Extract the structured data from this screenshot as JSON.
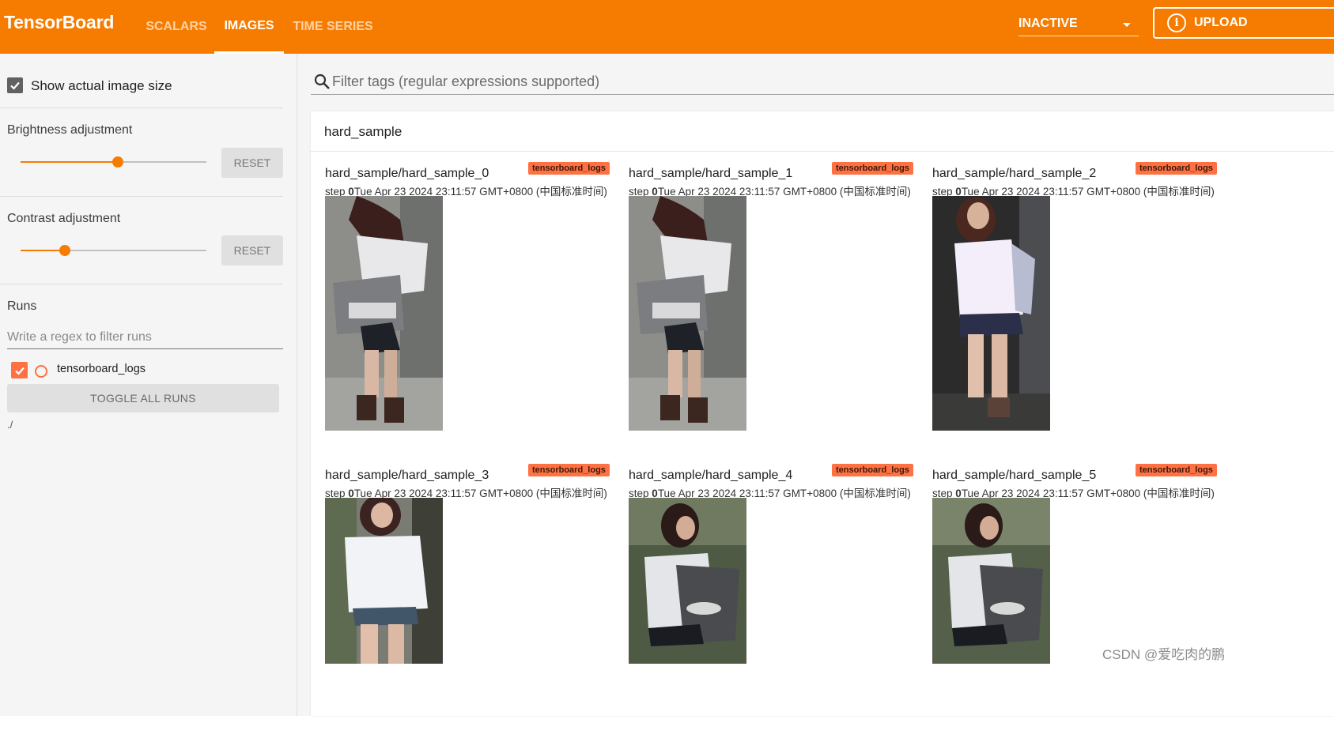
{
  "header": {
    "brand": "TensorBoard",
    "tabs": [
      {
        "label": "SCALARS",
        "active": false
      },
      {
        "label": "IMAGES",
        "active": true
      },
      {
        "label": "TIME SERIES",
        "active": false
      }
    ],
    "reload_status": "INACTIVE",
    "upload_label": "UPLOAD",
    "accent": "#f57c00"
  },
  "sidebar": {
    "show_actual_size_label": "Show actual image size",
    "show_actual_size_checked": true,
    "brightness": {
      "label": "Brightness adjustment",
      "reset": "RESET",
      "value_fraction": 0.52
    },
    "contrast": {
      "label": "Contrast adjustment",
      "reset": "RESET",
      "value_fraction": 0.24
    },
    "runs": {
      "title": "Runs",
      "filter_placeholder": "Write a regex to filter runs",
      "items": [
        {
          "name": "tensorboard_logs",
          "checked": true,
          "color": "#ff7043"
        }
      ],
      "toggle_all": "TOGGLE ALL RUNS",
      "path": "./"
    }
  },
  "main": {
    "filter_placeholder": "Filter tags (regular expressions supported)",
    "group_title": "hard_sample",
    "images": [
      {
        "tag": "hard_sample/hard_sample_0",
        "run": "tensorboard_logs",
        "step_label": "step",
        "step": "0",
        "time": "Tue Apr 23 2024 23:11:57 GMT+0800 (中国标准时间)"
      },
      {
        "tag": "hard_sample/hard_sample_1",
        "run": "tensorboard_logs",
        "step_label": "step",
        "step": "0",
        "time": "Tue Apr 23 2024 23:11:57 GMT+0800 (中国标准时间)"
      },
      {
        "tag": "hard_sample/hard_sample_2",
        "run": "tensorboard_logs",
        "step_label": "step",
        "step": "0",
        "time": "Tue Apr 23 2024 23:11:57 GMT+0800 (中国标准时间)"
      },
      {
        "tag": "hard_sample/hard_sample_3",
        "run": "tensorboard_logs",
        "step_label": "step",
        "step": "0",
        "time": "Tue Apr 23 2024 23:11:57 GMT+0800 (中国标准时间)"
      },
      {
        "tag": "hard_sample/hard_sample_4",
        "run": "tensorboard_logs",
        "step_label": "step",
        "step": "0",
        "time": "Tue Apr 23 2024 23:11:57 GMT+0800 (中国标准时间)"
      },
      {
        "tag": "hard_sample/hard_sample_5",
        "run": "tensorboard_logs",
        "step_label": "step",
        "step": "0",
        "time": "Tue Apr 23 2024 23:11:57 GMT+0800 (中国标准时间)"
      }
    ]
  },
  "watermark": "CSDN @爱吃肉的鹏"
}
